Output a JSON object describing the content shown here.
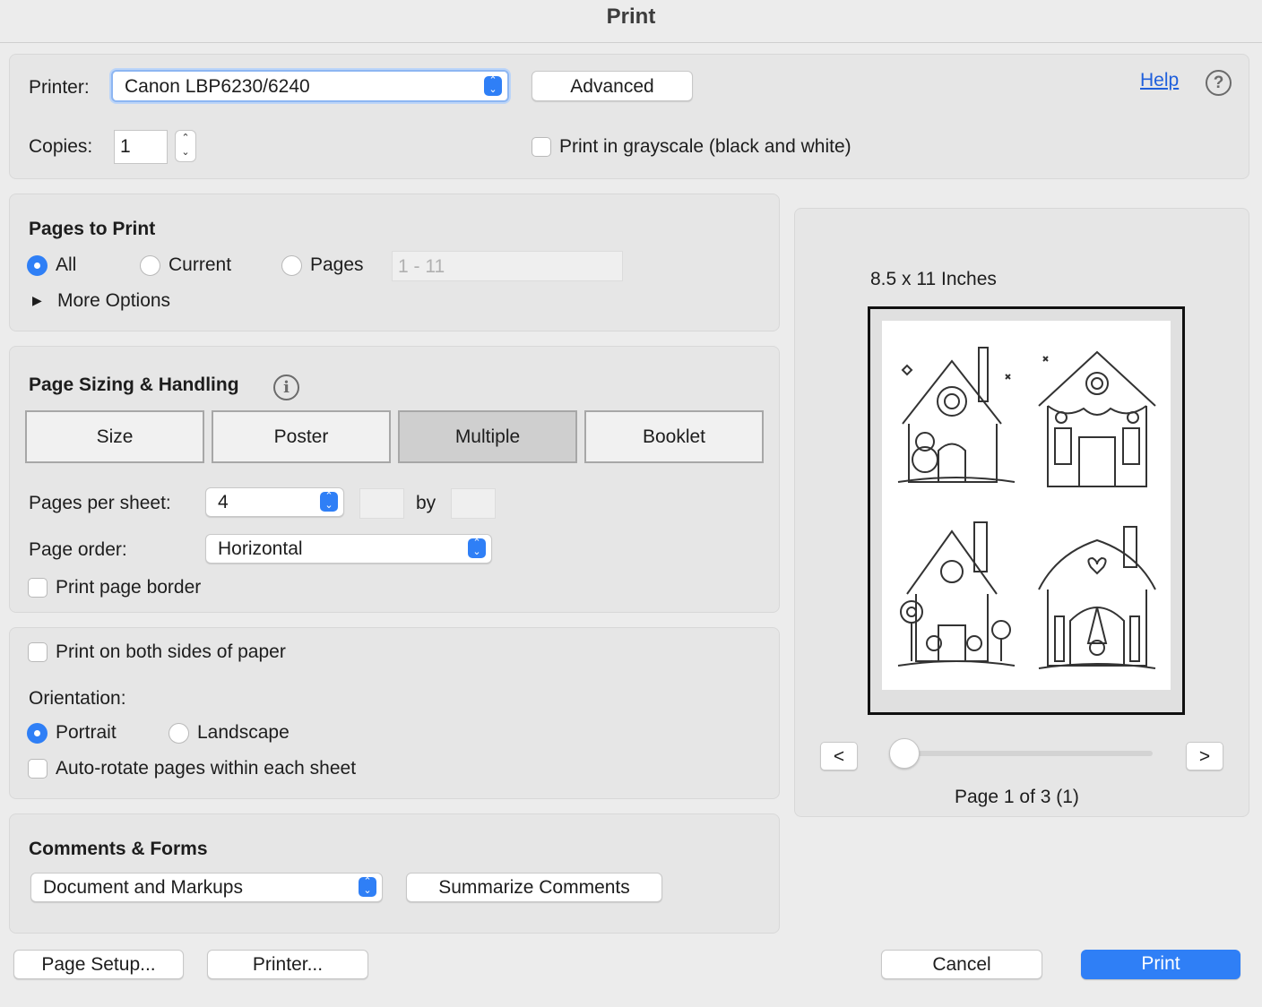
{
  "window": {
    "title": "Print"
  },
  "printer_section": {
    "printer_label": "Printer:",
    "printer_value": "Canon LBP6230/6240",
    "advanced_label": "Advanced",
    "help_label": "Help",
    "help_icon_glyph": "?",
    "copies_label": "Copies:",
    "copies_value": "1",
    "grayscale_label": "Print in grayscale (black and white)",
    "grayscale_checked": false
  },
  "pages_to_print": {
    "heading": "Pages to Print",
    "options": [
      {
        "label": "All",
        "selected": true
      },
      {
        "label": "Current",
        "selected": false
      },
      {
        "label": "Pages",
        "selected": false
      }
    ],
    "range_placeholder": "1 - 11",
    "more_options_label": "More Options"
  },
  "page_sizing": {
    "heading": "Page Sizing & Handling",
    "info_icon_glyph": "i",
    "tabs": [
      {
        "label": "Size",
        "selected": false
      },
      {
        "label": "Poster",
        "selected": false
      },
      {
        "label": "Multiple",
        "selected": true
      },
      {
        "label": "Booklet",
        "selected": false
      }
    ],
    "pages_per_sheet_label": "Pages per sheet:",
    "pages_per_sheet_value": "4",
    "by_label": "by",
    "page_order_label": "Page order:",
    "page_order_value": "Horizontal",
    "print_border_label": "Print page border",
    "print_border_checked": false
  },
  "layout_section": {
    "both_sides_label": "Print on both sides of paper",
    "both_sides_checked": false,
    "orientation_label": "Orientation:",
    "orientation_options": [
      {
        "label": "Portrait",
        "selected": true
      },
      {
        "label": "Landscape",
        "selected": false
      }
    ],
    "auto_rotate_label": "Auto-rotate pages within each sheet",
    "auto_rotate_checked": false
  },
  "comments_forms": {
    "heading": "Comments & Forms",
    "value": "Document and Markups",
    "summarize_label": "Summarize Comments"
  },
  "preview": {
    "paper_size_label": "8.5 x 11 Inches",
    "prev_label": "<",
    "next_label": ">",
    "page_status": "Page 1 of 3 (1)",
    "slider_position": 0
  },
  "footer": {
    "page_setup_label": "Page Setup...",
    "printer_label": "Printer...",
    "cancel_label": "Cancel",
    "print_label": "Print"
  },
  "colors": {
    "accent": "#2f7ff6",
    "link": "#1f5fdc",
    "panel_background": "#e6e6e6"
  }
}
